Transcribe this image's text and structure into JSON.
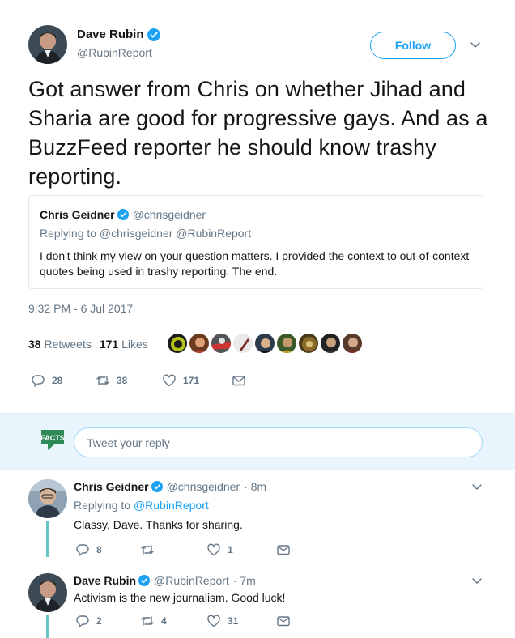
{
  "main_tweet": {
    "author_name": "Dave Rubin",
    "author_handle": "@RubinReport",
    "follow_label": "Follow",
    "text": "Got answer from Chris on whether Jihad and Sharia are good for progressive gays. And as a BuzzFeed reporter he should know trashy reporting.",
    "quoted": {
      "author_name": "Chris Geidner",
      "author_handle": "@chrisgeidner",
      "replying_to": "Replying to @chrisgeidner @RubinReport",
      "text": "I don't think my view on your question matters. I provided the context to out-of-context quotes being used in trashy reporting. The end."
    },
    "timestamp": "9:32 PM - 6 Jul 2017",
    "retweets_count": "38",
    "retweets_label": "Retweets",
    "likes_count": "171",
    "likes_label": "Likes",
    "actions": {
      "replies": "28",
      "retweets": "38",
      "likes": "171"
    }
  },
  "composer": {
    "placeholder": "Tweet your reply",
    "avatar_text": "FACTS"
  },
  "replies": [
    {
      "author_name": "Chris Geidner",
      "author_handle": "@chrisgeidner",
      "time": "· 8m",
      "replying_prefix": "Replying to",
      "replying_handle": "@RubinReport",
      "text": "Classy, Dave. Thanks for sharing.",
      "actions": {
        "replies": "8",
        "retweets": "",
        "likes": "1"
      }
    },
    {
      "author_name": "Dave Rubin",
      "author_handle": "@RubinReport",
      "time": "· 7m",
      "text": "Activism is the new journalism. Good luck!",
      "actions": {
        "replies": "2",
        "retweets": "4",
        "likes": "31"
      }
    }
  ],
  "colors": {
    "accent": "#1da1f2",
    "muted": "#657786",
    "thread_line": "#66c4c2",
    "composer_bg": "#e8f5fd"
  },
  "icons": [
    "verified-badge-icon",
    "chevron-down-icon",
    "reply-icon",
    "retweet-icon",
    "like-icon",
    "direct-message-icon"
  ]
}
